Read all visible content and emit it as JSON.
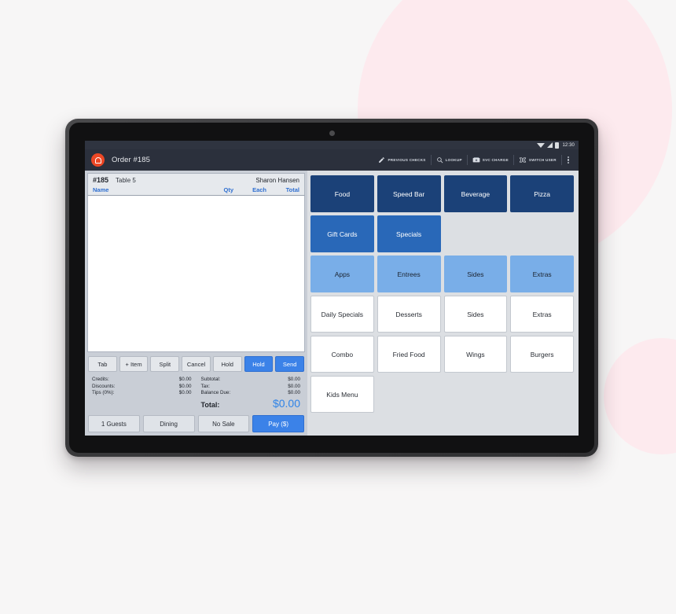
{
  "status_bar": {
    "clock": "12:30",
    "icons": [
      "wifi-icon",
      "signal-icon",
      "battery-icon"
    ]
  },
  "app_bar": {
    "logo": "app-logo-icon",
    "title": "Order #185",
    "actions": [
      {
        "label": "PREVIOUS CHECKS",
        "icon": "pencil-icon"
      },
      {
        "label": "LOOKUP",
        "icon": "search-icon"
      },
      {
        "label": "SVC CHARGE",
        "icon": "money-icon"
      },
      {
        "label": "SWITCH USER",
        "icon": "switch-user-icon"
      }
    ],
    "overflow": "kebab-menu-icon"
  },
  "order_panel": {
    "order_number": "#185",
    "table": "Table 5",
    "server": "Sharon Hansen",
    "columns": {
      "name": "Name",
      "qty": "Qty",
      "each": "Each",
      "total": "Total"
    },
    "items": [],
    "actions": [
      {
        "label": "Tab",
        "style": "grey"
      },
      {
        "label": "+ Item",
        "style": "grey"
      },
      {
        "label": "Split",
        "style": "grey"
      },
      {
        "label": "Cancel",
        "style": "grey"
      },
      {
        "label": "Hold",
        "style": "grey"
      },
      {
        "label": "Hold",
        "style": "blue"
      },
      {
        "label": "Send",
        "style": "blue"
      }
    ],
    "totals_left": [
      {
        "label": "Credits:",
        "value": "$0.00"
      },
      {
        "label": "Discounts:",
        "value": "$0.00"
      },
      {
        "label": "Tips (0%):",
        "value": "$0.00"
      }
    ],
    "totals_right": [
      {
        "label": "Subtotal:",
        "value": "$0.00"
      },
      {
        "label": "Tax:",
        "value": "$0.00"
      },
      {
        "label": "Balance Due:",
        "value": "$0.00"
      }
    ],
    "grand_total": {
      "label": "Total:",
      "value": "$0.00"
    },
    "footer": [
      {
        "label": "1 Guests",
        "style": "grey"
      },
      {
        "label": "Dining",
        "style": "grey"
      },
      {
        "label": "No Sale",
        "style": "grey"
      },
      {
        "label": "Pay ($)",
        "style": "blue"
      }
    ]
  },
  "menu_panel": {
    "groups": [
      {
        "name": "categories-primary",
        "buttons": [
          {
            "label": "Food",
            "style": "navy"
          },
          {
            "label": "Speed Bar",
            "style": "navy"
          },
          {
            "label": "Beverage",
            "style": "navy"
          },
          {
            "label": "Pizza",
            "style": "navy"
          },
          {
            "label": "Gift Cards",
            "style": "mid"
          },
          {
            "label": "Specials",
            "style": "mid"
          }
        ]
      },
      {
        "name": "categories-secondary",
        "buttons": [
          {
            "label": "Apps",
            "style": "light"
          },
          {
            "label": "Entrees",
            "style": "light"
          },
          {
            "label": "Sides",
            "style": "light"
          },
          {
            "label": "Extras",
            "style": "light"
          }
        ]
      },
      {
        "name": "menu-items",
        "buttons": [
          {
            "label": "Daily Specials",
            "style": "white"
          },
          {
            "label": "Desserts",
            "style": "white"
          },
          {
            "label": "Sides",
            "style": "white"
          },
          {
            "label": "Extras",
            "style": "white"
          },
          {
            "label": "Combo",
            "style": "white"
          },
          {
            "label": "Fried Food",
            "style": "white"
          },
          {
            "label": "Wings",
            "style": "white"
          },
          {
            "label": "Burgers",
            "style": "white"
          },
          {
            "label": "Kids Menu",
            "style": "white"
          }
        ]
      }
    ]
  },
  "colors": {
    "accent_orange": "#ec4725",
    "accent_blue": "#3b82e8",
    "navy": "#1b4178",
    "mid_blue": "#2968b8",
    "light_blue": "#79aee8",
    "app_bar": "#2b303c",
    "background": "#f7f6f6",
    "blob_pink": "#fdeaee"
  }
}
